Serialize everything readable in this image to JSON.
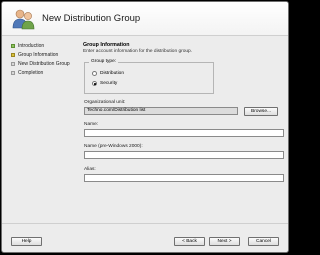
{
  "window": {
    "title": "New Distribution Group"
  },
  "steps": [
    {
      "label": "Introduction",
      "state": "done"
    },
    {
      "label": "Group Information",
      "state": "current"
    },
    {
      "label": "New Distribution Group",
      "state": "pending"
    },
    {
      "label": "Completion",
      "state": "pending"
    }
  ],
  "section": {
    "title": "Group Information",
    "description": "Enter account information for the distribution group."
  },
  "group_type": {
    "legend": "Group type:",
    "options": [
      "Distribution",
      "Security"
    ],
    "selected": "Security"
  },
  "org_unit": {
    "label": "Organizational unit:",
    "value": "Techno.com/Distribution list",
    "browse_label": "Browse..."
  },
  "name_field": {
    "label": "Name:",
    "value": ""
  },
  "prewin_field": {
    "label": "Name (pre-Windows 2000):",
    "value": ""
  },
  "alias_field": {
    "label": "Alias:",
    "value": ""
  },
  "footer": {
    "help": "Help",
    "back": "< Back",
    "next": "Next >",
    "cancel": "Cancel"
  },
  "colors": {
    "step_done": "#8fc35f",
    "step_current": "#d9c13a",
    "step_pending": "#d8d8d8"
  }
}
